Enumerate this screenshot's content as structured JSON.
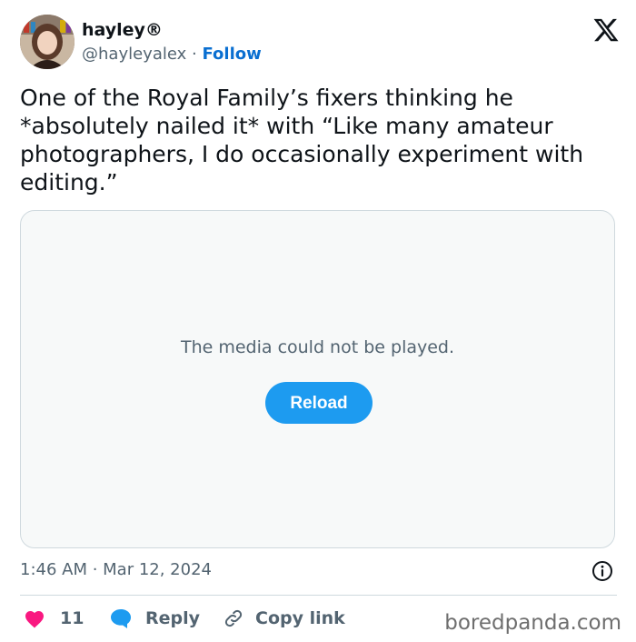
{
  "author": {
    "name": "hayley®",
    "handle": "@hayleyalex",
    "separator": "·",
    "follow_label": "Follow"
  },
  "platform_icon": "x-logo-icon",
  "tweet": {
    "text": "One of the Royal Family’s fixers thinking he *absolutely nailed it* with “Like many amateur photographers, I do occasionally experiment with editing.”"
  },
  "media": {
    "message": "The media could not be played.",
    "reload_label": "Reload"
  },
  "timestamp": "1:46 AM · Mar 12, 2024",
  "actions": {
    "like_count": "11",
    "reply_label": "Reply",
    "copy_label": "Copy link"
  },
  "watermark": "boredpanda.com",
  "colors": {
    "accent": "#1d9bf0",
    "follow": "#0a6fd1",
    "like": "#f91880",
    "muted": "#536471"
  }
}
